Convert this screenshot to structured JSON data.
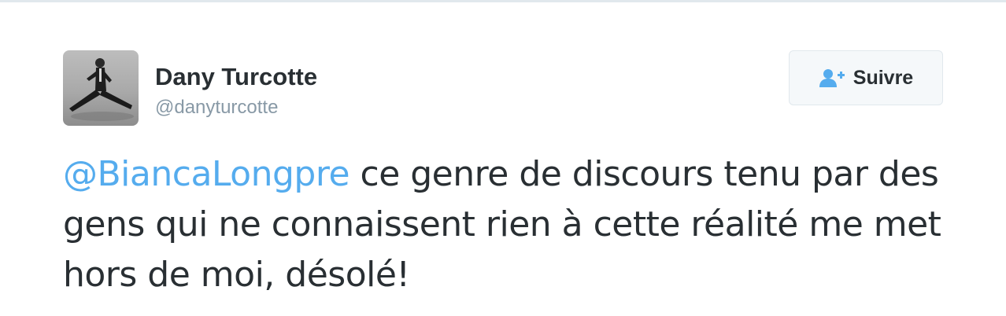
{
  "tweet": {
    "author_name": "Dany Turcotte",
    "author_handle": "@danyturcotte",
    "follow_label": "Suivre",
    "mention": "@BiancaLongpre",
    "text_after_mention": " ce genre de discours tenu par des gens qui ne connaissent rien à cette réalité me met hors de moi, désolé!"
  },
  "colors": {
    "mention": "#55acee",
    "text": "#292f33",
    "handle": "#8899a6",
    "button_border": "#e1e8ed"
  },
  "icons": {
    "follow": "person-plus-icon",
    "avatar": "profile-photo"
  }
}
